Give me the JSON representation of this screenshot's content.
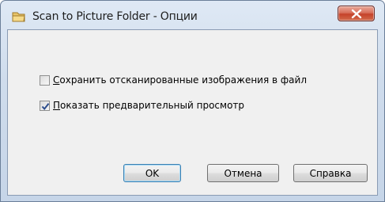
{
  "window": {
    "title": "Scan to Picture Folder - Опции",
    "close_glyph": "X"
  },
  "options": {
    "save_scanned": {
      "label_first": "С",
      "label_rest": "охранить отсканированные изображения в файл",
      "checked": false
    },
    "show_preview": {
      "label_first": "П",
      "label_rest": "оказать предварительный просмотр",
      "checked": true
    }
  },
  "buttons": {
    "ok_label": "OK",
    "cancel_label": "Отмена",
    "help_label": "Справка"
  },
  "colors": {
    "titlebar": "#cfdcec",
    "client_bg": "#f0f0f0",
    "close_button": "#c5422a",
    "default_button_border": "#3c7fb1",
    "checkmark": "#2b4c8c"
  },
  "icons": {
    "title": "folder-icon",
    "close": "close-icon",
    "check": "checkmark-icon"
  }
}
